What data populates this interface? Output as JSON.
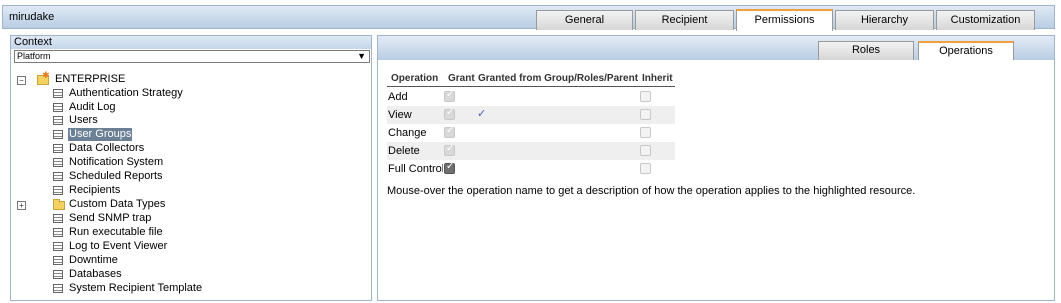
{
  "header": {
    "user": "mirudake",
    "tabs": [
      {
        "label": "General",
        "active": false
      },
      {
        "label": "Recipient",
        "active": false
      },
      {
        "label": "Permissions",
        "active": true
      },
      {
        "label": "Hierarchy",
        "active": false
      },
      {
        "label": "Customization",
        "active": false
      }
    ]
  },
  "context": {
    "title": "Context",
    "selected": "Platform"
  },
  "tree": {
    "root": "ENTERPRISE",
    "items": [
      "Authentication Strategy",
      "Audit Log",
      "Users",
      "User Groups",
      "Data Collectors",
      "Notification System",
      "Scheduled Reports",
      "Recipients",
      "Custom Data Types",
      "Send SNMP trap",
      "Run executable file",
      "Log to Event Viewer",
      "Downtime",
      "Databases",
      "System Recipient Template"
    ],
    "selected_item": "User Groups"
  },
  "subtabs": [
    {
      "label": "Roles",
      "active": false
    },
    {
      "label": "Operations",
      "active": true
    }
  ],
  "operations": {
    "columns": [
      "Operation",
      "Grant",
      "Granted from Group/Roles/Parent",
      "Inherit"
    ],
    "rows": [
      {
        "name": "Add",
        "grant": "disabled-checked",
        "granted_from": false
      },
      {
        "name": "View",
        "grant": "disabled-checked",
        "granted_from": true
      },
      {
        "name": "Change",
        "grant": "disabled-checked",
        "granted_from": false
      },
      {
        "name": "Delete",
        "grant": "disabled-checked",
        "granted_from": false
      },
      {
        "name": "Full Control",
        "grant": "checked",
        "granted_from": false
      }
    ],
    "hint": "Mouse-over the operation name to get a description of how the operation applies to the highlighted resource."
  }
}
